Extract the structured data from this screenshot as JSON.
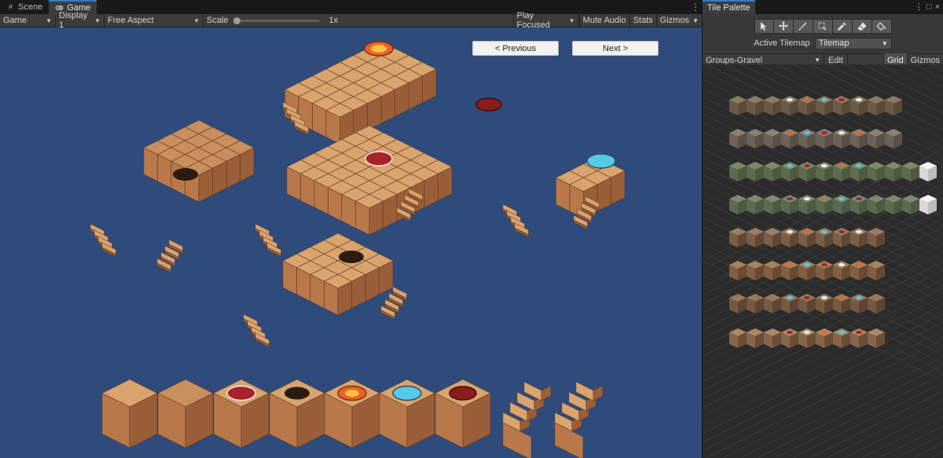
{
  "game_window": {
    "tabs": [
      {
        "label": "Scene",
        "icon": "grid-icon"
      },
      {
        "label": "Game",
        "icon": "gamepad-icon"
      }
    ],
    "toolbar": {
      "mode": "Game",
      "display": "Display 1",
      "aspect": "Free Aspect",
      "scale_label": "Scale",
      "scale_value": "1x",
      "play_mode": "Play Focused",
      "mute_audio": "Mute Audio",
      "stats": "Stats",
      "gizmos": "Gizmos"
    },
    "buttons": {
      "previous": "< Previous",
      "next": "Next >"
    },
    "colors": {
      "viewport_bg": "#2e4b7c",
      "sand_top": "#d9a46e",
      "sand_left": "#b8784a",
      "sand_right": "#9a5f38",
      "accent": "#3a79bb"
    }
  },
  "tile_palette": {
    "tab_label": "Tile Palette",
    "tools": [
      "select-tool-icon",
      "move-tool-icon",
      "paint-tool-icon",
      "box-fill-tool-icon",
      "picker-tool-icon",
      "eraser-tool-icon",
      "fill-tool-icon"
    ],
    "active_tilemap_label": "Active Tilemap",
    "active_tilemap_value": "Tilemap",
    "palette_name": "Groups-Gravel",
    "edit_label": "Edit",
    "grid_label": "Grid",
    "gizmos_label": "Gizmos"
  }
}
